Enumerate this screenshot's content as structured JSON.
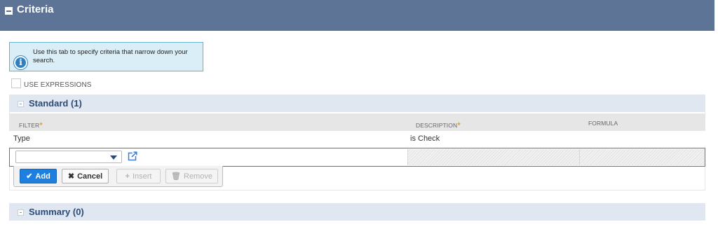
{
  "header": {
    "title": "Criteria"
  },
  "info": {
    "text": "Use this tab to specify criteria that narrow down your search.",
    "icon": "info-icon"
  },
  "options": {
    "use_expressions_label": "USE EXPRESSIONS",
    "use_expressions_checked": false
  },
  "standard": {
    "title": "Standard (1)",
    "columns": {
      "filter": "FILTER",
      "description": "DESCRIPTION",
      "formula": "FORMULA"
    },
    "rows": [
      {
        "filter": "Type",
        "description": "is Check",
        "formula": ""
      }
    ],
    "edit_row": {
      "filter_value": ""
    }
  },
  "actions": {
    "add": "Add",
    "cancel": "Cancel",
    "insert": "Insert",
    "remove": "Remove"
  },
  "summary": {
    "title": "Summary (0)"
  },
  "colors": {
    "header_bg": "#5e7496",
    "section_bg": "#e1e7f0",
    "section_text": "#2a4a78",
    "primary_button": "#1d7fe0",
    "info_bg": "#d9eef7",
    "required_marker": "#e08a1e"
  }
}
